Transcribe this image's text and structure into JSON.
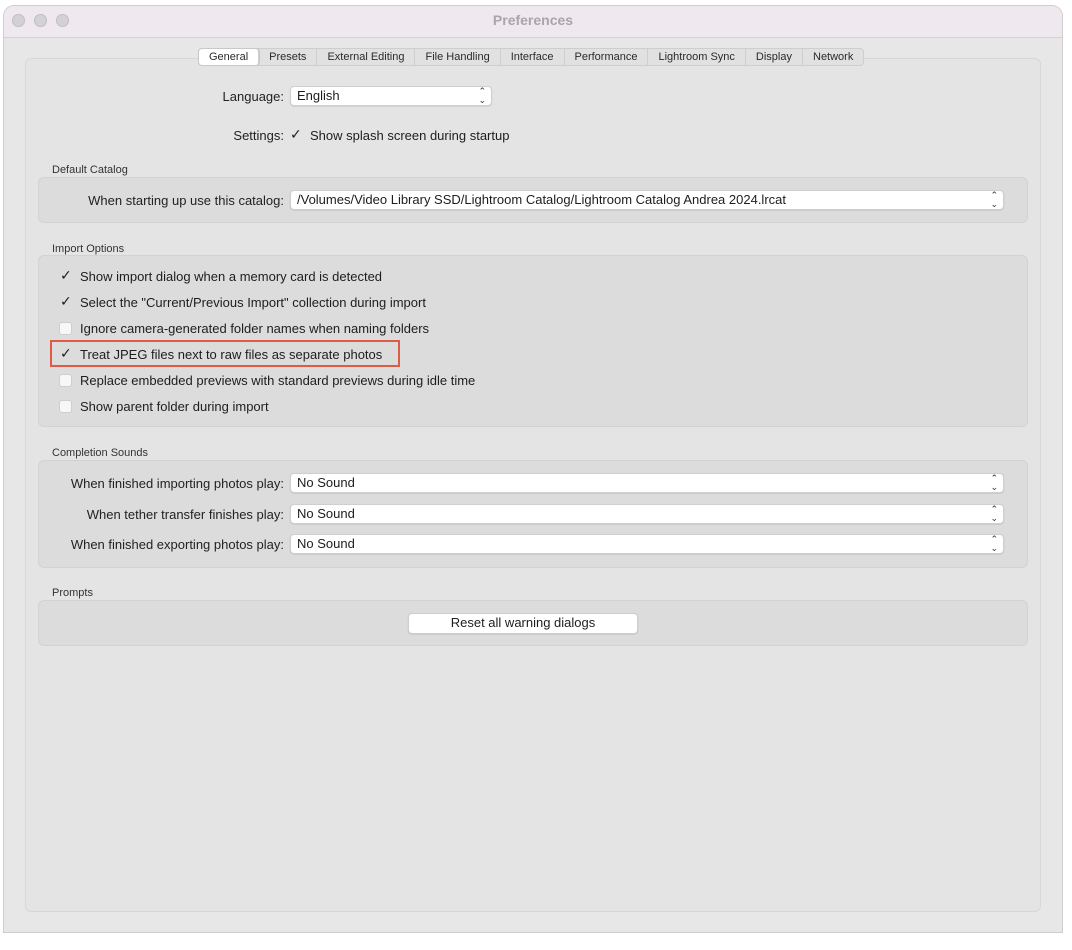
{
  "window": {
    "title": "Preferences"
  },
  "tabs": [
    "General",
    "Presets",
    "External Editing",
    "File Handling",
    "Interface",
    "Performance",
    "Lightroom Sync",
    "Display",
    "Network"
  ],
  "active_tab": "General",
  "general": {
    "language_label": "Language:",
    "language_value": "English",
    "settings_label": "Settings:",
    "splash_label": "Show splash screen during startup",
    "splash_checked": true
  },
  "default_catalog": {
    "section_title": "Default Catalog",
    "label": "When starting up use this catalog:",
    "value": "/Volumes/Video Library SSD/Lightroom Catalog/Lightroom Catalog Andrea 2024.lrcat"
  },
  "import_options": {
    "section_title": "Import Options",
    "items": [
      {
        "label": "Show import dialog when a memory card is detected",
        "checked": true
      },
      {
        "label": "Select the \"Current/Previous Import\" collection during import",
        "checked": true
      },
      {
        "label": "Ignore camera-generated folder names when naming folders",
        "checked": false
      },
      {
        "label": "Treat JPEG files next to raw files as separate photos",
        "checked": true
      },
      {
        "label": "Replace embedded previews with standard previews during idle time",
        "checked": false
      },
      {
        "label": "Show parent folder during import",
        "checked": false
      }
    ]
  },
  "completion_sounds": {
    "section_title": "Completion Sounds",
    "rows": [
      {
        "label": "When finished importing photos play:",
        "value": "No Sound"
      },
      {
        "label": "When tether transfer finishes play:",
        "value": "No Sound"
      },
      {
        "label": "When finished exporting photos play:",
        "value": "No Sound"
      }
    ]
  },
  "prompts": {
    "section_title": "Prompts",
    "reset_button": "Reset all warning dialogs"
  },
  "colors": {
    "highlight": "#e05a47"
  }
}
